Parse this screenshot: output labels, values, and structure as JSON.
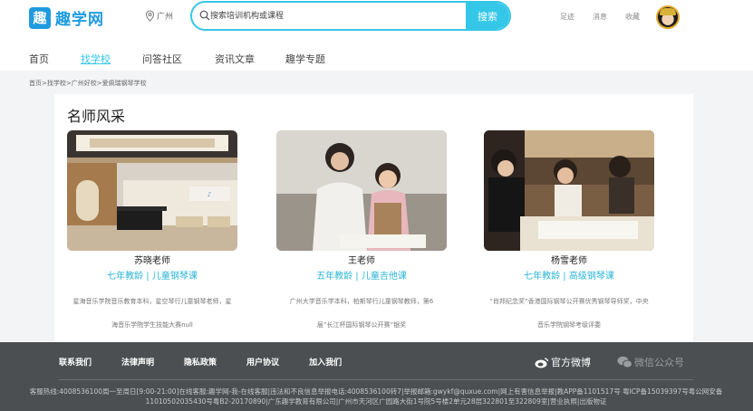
{
  "header": {
    "logo_glyph": "趣",
    "logo_text": "趣学网",
    "location": "广州",
    "search_placeholder": "搜索培训机构或课程",
    "search_button": "搜索",
    "links": [
      "足迹",
      "消息",
      "收藏"
    ]
  },
  "nav": {
    "items": [
      "首页",
      "找学校",
      "问答社区",
      "资讯文章",
      "趣学专题"
    ],
    "active_index": 1
  },
  "breadcrumb": "首页>找学校>广州好校>爱佩瑞钢琴学校",
  "section_title": "名师风采",
  "teachers": [
    {
      "name": "苏晓老师",
      "tags": "七年教龄 | 儿童钢琴课",
      "desc": "星海音乐学院音乐教育本科，星空琴行儿童钢琴老师，星海音乐学院学生技能大赛null"
    },
    {
      "name": "王老师",
      "tags": "五年教龄 | 儿童吉他课",
      "desc": "广州大学音乐学本科，柏斯琴行儿童钢琴教师，第6届“长江杯国际钢琴公开赛”银奖"
    },
    {
      "name": "杨雪老师",
      "tags": "七年教龄 | 高级钢琴课",
      "desc": "“肖邦纪念奖”香港国际钢琴公开赛优秀钢琴导师奖，中央音乐学院钢琴考级评委"
    }
  ],
  "footer": {
    "links": [
      "联系我们",
      "法律声明",
      "隐私政策",
      "用户协议",
      "加入我们"
    ],
    "weibo": "官方微博",
    "wechat": "微信公众号",
    "info": "客服热线:4008536100周一至周日[9:00-21:00]在线客服:趣学网-我-在线客服|违法和不良信息举报电话:4008536100转7|举报邮箱:gwykf@quxue.com|网上有害信息举报|教APP备1101517号 粤ICP备15039397号粤公网安备11010502035430号粤B2-20170890|广东趣学教育有限公司|广州市天河区广园路大街1号院5号楼2单元28层322801至322809室|营业执照|出版物证"
  },
  "colors": {
    "accent": "#35c7e8",
    "brand": "#1e9be0",
    "footer_bg": "#4b4f51"
  }
}
